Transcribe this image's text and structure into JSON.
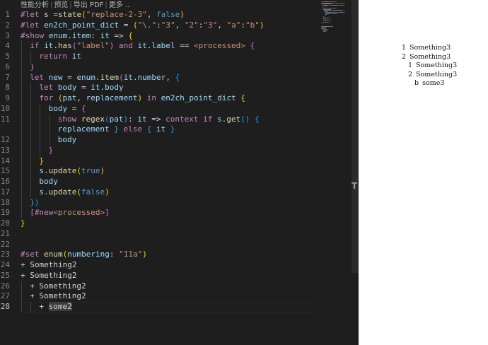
{
  "toolbar": {
    "items": [
      "性能分析",
      "预览",
      "导出 PDF",
      "更多 .."
    ]
  },
  "editor": {
    "lines": [
      {
        "n": "1",
        "indent": 0,
        "tokens": [
          [
            "k",
            "#let "
          ],
          [
            "t",
            "s ="
          ],
          [
            "f",
            "state"
          ],
          [
            "b1",
            "("
          ],
          [
            "s",
            "\"replace-2-3\""
          ],
          [
            "t",
            ", "
          ],
          [
            "kw",
            "false"
          ],
          [
            "b1",
            ")"
          ]
        ]
      },
      {
        "n": "2",
        "indent": 0,
        "tokens": [
          [
            "k",
            "#let "
          ],
          [
            "v",
            "en2ch_point_dict"
          ],
          [
            "t",
            " = "
          ],
          [
            "b1",
            "("
          ],
          [
            "s",
            "\"\\.\""
          ],
          [
            "t",
            ":"
          ],
          [
            "s",
            "\"3\""
          ],
          [
            "t",
            ", "
          ],
          [
            "s",
            "\"2\""
          ],
          [
            "t",
            ":"
          ],
          [
            "s",
            "\"3\""
          ],
          [
            "t",
            ", "
          ],
          [
            "s",
            "\"a\""
          ],
          [
            "t",
            ":"
          ],
          [
            "s",
            "\"b\""
          ],
          [
            "b1",
            ")"
          ]
        ]
      },
      {
        "n": "3",
        "indent": 0,
        "tokens": [
          [
            "k",
            "#show "
          ],
          [
            "v",
            "enum"
          ],
          [
            "t",
            "."
          ],
          [
            "v",
            "item"
          ],
          [
            "t",
            ": "
          ],
          [
            "v",
            "it"
          ],
          [
            "t",
            " => "
          ],
          [
            "b1",
            "{"
          ]
        ]
      },
      {
        "n": "4",
        "indent": 1,
        "tokens": [
          [
            "k",
            "if "
          ],
          [
            "v",
            "it"
          ],
          [
            "t",
            "."
          ],
          [
            "f",
            "has"
          ],
          [
            "b2",
            "("
          ],
          [
            "s",
            "\"label\""
          ],
          [
            "b2",
            ")"
          ],
          [
            "k",
            " and "
          ],
          [
            "v",
            "it"
          ],
          [
            "t",
            "."
          ],
          [
            "v",
            "label"
          ],
          [
            "t",
            " == "
          ],
          [
            "s",
            "<processed>"
          ],
          [
            "t",
            " "
          ],
          [
            "b2",
            "{"
          ]
        ]
      },
      {
        "n": "5",
        "indent": 2,
        "tokens": [
          [
            "k",
            "return "
          ],
          [
            "v",
            "it"
          ]
        ]
      },
      {
        "n": "6",
        "indent": 1,
        "tokens": [
          [
            "b2",
            "}"
          ]
        ]
      },
      {
        "n": "7",
        "indent": 1,
        "tokens": [
          [
            "k",
            "let "
          ],
          [
            "v",
            "new"
          ],
          [
            "t",
            " = "
          ],
          [
            "v",
            "enum"
          ],
          [
            "t",
            "."
          ],
          [
            "f",
            "item"
          ],
          [
            "b2",
            "("
          ],
          [
            "v",
            "it"
          ],
          [
            "t",
            "."
          ],
          [
            "v",
            "number"
          ],
          [
            "t",
            ", "
          ],
          [
            "b3",
            "{"
          ]
        ]
      },
      {
        "n": "8",
        "indent": 2,
        "tokens": [
          [
            "k",
            "let "
          ],
          [
            "v",
            "body"
          ],
          [
            "t",
            " = "
          ],
          [
            "v",
            "it"
          ],
          [
            "t",
            "."
          ],
          [
            "v",
            "body"
          ]
        ]
      },
      {
        "n": "9",
        "indent": 2,
        "tokens": [
          [
            "k",
            "for "
          ],
          [
            "b1",
            "("
          ],
          [
            "v",
            "pat"
          ],
          [
            "t",
            ", "
          ],
          [
            "v",
            "replacement"
          ],
          [
            "b1",
            ")"
          ],
          [
            "k",
            " in "
          ],
          [
            "v",
            "en2ch_point_dict"
          ],
          [
            "t",
            " "
          ],
          [
            "b1",
            "{"
          ]
        ]
      },
      {
        "n": "10",
        "indent": 3,
        "tokens": [
          [
            "v",
            "body"
          ],
          [
            "t",
            " = "
          ],
          [
            "b2",
            "{"
          ]
        ]
      },
      {
        "n": "11",
        "indent": 4,
        "tokens": [
          [
            "k",
            "show "
          ],
          [
            "f",
            "regex"
          ],
          [
            "b3",
            "("
          ],
          [
            "v",
            "pat"
          ],
          [
            "b3",
            ")"
          ],
          [
            "t",
            ": "
          ],
          [
            "v",
            "it"
          ],
          [
            "t",
            " => "
          ],
          [
            "k",
            "context "
          ],
          [
            "k",
            "if "
          ],
          [
            "v",
            "s"
          ],
          [
            "t",
            "."
          ],
          [
            "f",
            "get"
          ],
          [
            "b3",
            "()"
          ],
          [
            "t",
            " "
          ],
          [
            "b3",
            "{"
          ]
        ]
      },
      {
        "n": "",
        "indent": 4,
        "tokens": [
          [
            "v",
            "replacement"
          ],
          [
            "t",
            " "
          ],
          [
            "b3",
            "}"
          ],
          [
            "k",
            " else "
          ],
          [
            "b3",
            "{"
          ],
          [
            "t",
            " "
          ],
          [
            "v",
            "it"
          ],
          [
            "t",
            " "
          ],
          [
            "b3",
            "}"
          ]
        ]
      },
      {
        "n": "12",
        "indent": 4,
        "tokens": [
          [
            "v",
            "body"
          ]
        ]
      },
      {
        "n": "13",
        "indent": 3,
        "tokens": [
          [
            "b2",
            "}"
          ]
        ]
      },
      {
        "n": "14",
        "indent": 2,
        "tokens": [
          [
            "b1",
            "}"
          ]
        ]
      },
      {
        "n": "15",
        "indent": 2,
        "tokens": [
          [
            "v",
            "s"
          ],
          [
            "t",
            "."
          ],
          [
            "f",
            "update"
          ],
          [
            "b1",
            "("
          ],
          [
            "kw",
            "true"
          ],
          [
            "b1",
            ")"
          ]
        ]
      },
      {
        "n": "16",
        "indent": 2,
        "tokens": [
          [
            "v",
            "body"
          ]
        ]
      },
      {
        "n": "17",
        "indent": 2,
        "tokens": [
          [
            "v",
            "s"
          ],
          [
            "t",
            "."
          ],
          [
            "f",
            "update"
          ],
          [
            "b1",
            "("
          ],
          [
            "kw",
            "false"
          ],
          [
            "b1",
            ")"
          ]
        ]
      },
      {
        "n": "18",
        "indent": 1,
        "tokens": [
          [
            "b3",
            "})"
          ]
        ]
      },
      {
        "n": "19",
        "indent": 1,
        "tokens": [
          [
            "b2",
            "["
          ],
          [
            "k",
            "#new"
          ],
          [
            "s",
            "<processed>"
          ],
          [
            "b2",
            "]"
          ]
        ]
      },
      {
        "n": "20",
        "indent": 0,
        "tokens": [
          [
            "b1",
            "}"
          ]
        ]
      },
      {
        "n": "21",
        "indent": 0,
        "tokens": []
      },
      {
        "n": "22",
        "indent": 0,
        "tokens": []
      },
      {
        "n": "23",
        "indent": 0,
        "tokens": [
          [
            "k",
            "#set "
          ],
          [
            "f",
            "enum"
          ],
          [
            "b1",
            "("
          ],
          [
            "v",
            "numbering"
          ],
          [
            "t",
            ": "
          ],
          [
            "s",
            "\"11a\""
          ],
          [
            "b1",
            ")"
          ]
        ]
      },
      {
        "n": "24",
        "indent": 0,
        "tokens": [
          [
            "t",
            "+ Something2"
          ]
        ]
      },
      {
        "n": "25",
        "indent": 0,
        "tokens": [
          [
            "t",
            "+ Something2"
          ]
        ]
      },
      {
        "n": "26",
        "indent": 1,
        "tokens": [
          [
            "t",
            "+ Something2"
          ]
        ]
      },
      {
        "n": "27",
        "indent": 1,
        "tokens": [
          [
            "t",
            "+ Something2"
          ]
        ]
      },
      {
        "n": "28",
        "indent": 2,
        "tokens": [
          [
            "t",
            "+ "
          ],
          [
            "sel",
            "some2"
          ]
        ],
        "active": true
      }
    ],
    "scrollbar_glyph": "T"
  },
  "preview": {
    "items": [
      {
        "num": "1",
        "text": "Something3"
      },
      {
        "num": "2",
        "text": "Something3"
      },
      {
        "num": "1",
        "text": "Something3"
      },
      {
        "num": "2",
        "text": "Something3"
      },
      {
        "num": "b",
        "text": "some3"
      }
    ]
  }
}
